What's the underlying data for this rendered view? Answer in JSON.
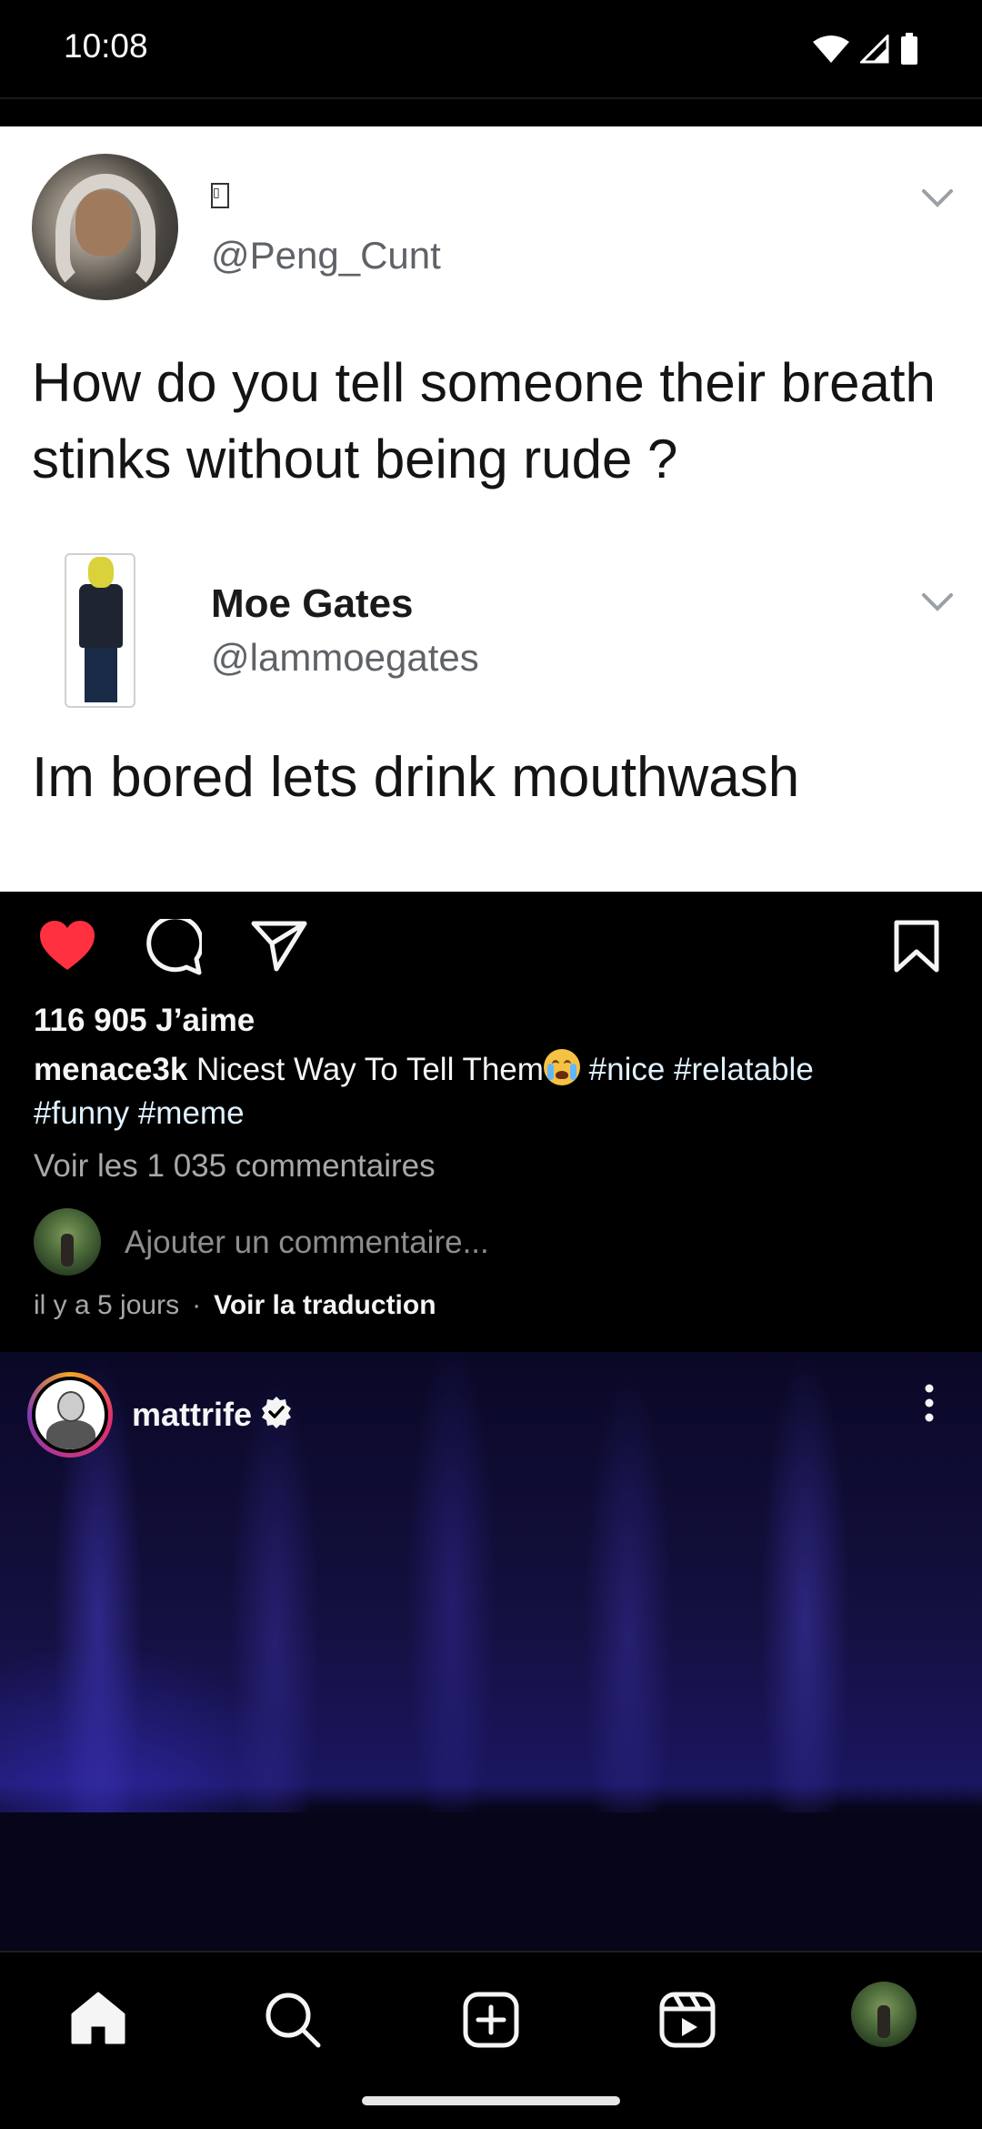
{
  "status_bar": {
    "time": "10:08",
    "icons": [
      "wifi-icon",
      "signal-icon",
      "battery-icon"
    ]
  },
  "post1": {
    "media": {
      "type": "tweet-screenshot",
      "tweet1": {
        "name_glyph": "▯",
        "handle": "@Peng_Cunt",
        "text": "How do you tell someone their breath stinks without being rude ?"
      },
      "tweet2": {
        "name": "Moe Gates",
        "handle": "@lammoegates",
        "text": "Im bored lets drink mouthwash"
      }
    },
    "liked": true,
    "like_color": "#ff3040",
    "likes_label": "116 905 J’aime",
    "caption": {
      "username": "menace3k",
      "text": "Nicest Way To Tell Them",
      "emoji": "loudly-crying-face",
      "hashtags": [
        "#nice",
        "#relatable",
        "#funny",
        "#meme"
      ]
    },
    "view_comments_label": "Voir les 1 035 commentaires",
    "comment_placeholder": "Ajouter un commentaire...",
    "time_ago": "il y a 5 jours",
    "translate_label": "Voir la traduction"
  },
  "post2": {
    "username": "mattrife",
    "verified": true
  },
  "bottom_nav": {
    "items": [
      "home-icon",
      "search-icon",
      "create-icon",
      "reels-icon",
      "profile-avatar"
    ]
  }
}
